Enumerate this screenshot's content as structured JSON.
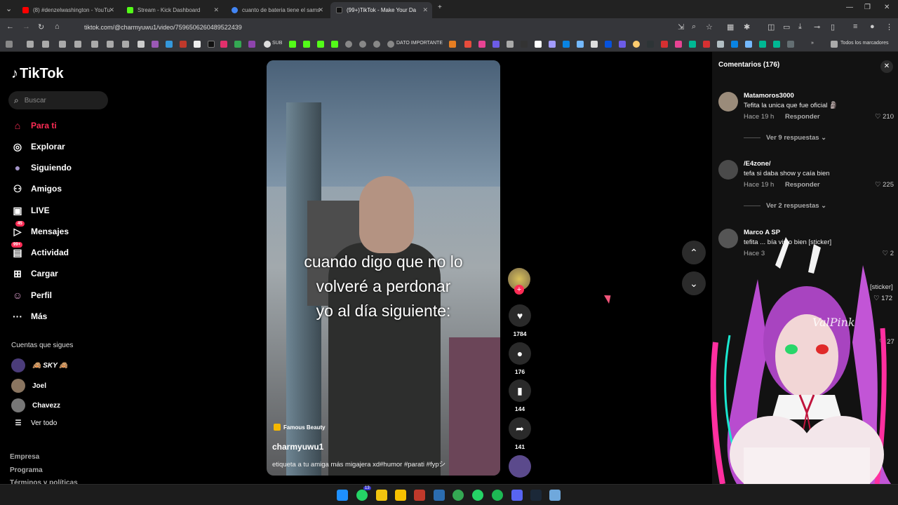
{
  "browser": {
    "tabs": [
      {
        "label": "(8) #denzelwashington - YouTu",
        "color": "#ff0000"
      },
      {
        "label": "Stream - Kick Dashboard",
        "color": "#53fc18"
      },
      {
        "label": "cuanto de bateria tiene el sams",
        "color": "#4285f4"
      },
      {
        "label": "(99+)TikTok - Make Your Da",
        "color": "#111111",
        "active": true
      }
    ],
    "url": "tiktok.com/@charmyuwu1/video/7596506260489522439",
    "bookmarks": {
      "sub": "SUB",
      "dato": "DATO IMPORTANTE",
      "all": "Todos los marcadores"
    }
  },
  "sidebar": {
    "logo": "TikTok",
    "search_placeholder": "Buscar",
    "items": [
      {
        "label": "Para ti",
        "icon": "home-icon",
        "glyph": "⌂",
        "active": true
      },
      {
        "label": "Explorar",
        "icon": "compass-icon",
        "glyph": "◎"
      },
      {
        "label": "Siguiendo",
        "icon": "following-icon",
        "glyph": "●"
      },
      {
        "label": "Amigos",
        "icon": "friends-icon",
        "glyph": "⚇"
      },
      {
        "label": "LIVE",
        "icon": "live-icon",
        "glyph": "▣"
      },
      {
        "label": "Mensajes",
        "icon": "messages-icon",
        "glyph": "▷",
        "badge": "45"
      },
      {
        "label": "Actividad",
        "icon": "activity-icon",
        "glyph": "▤",
        "badge": "99+"
      },
      {
        "label": "Cargar",
        "icon": "upload-icon",
        "glyph": "⊞"
      },
      {
        "label": "Perfil",
        "icon": "profile-icon",
        "glyph": "☺"
      },
      {
        "label": "Más",
        "icon": "more-icon",
        "glyph": "···"
      }
    ],
    "following_title": "Cuentas que sigues",
    "following": [
      {
        "name": "🙈 SKY 🙈"
      },
      {
        "name": "Joel"
      },
      {
        "name": "Chavezz"
      },
      {
        "name": "Ver todo"
      }
    ],
    "footer": [
      "Empresa",
      "Programa",
      "Términos y políticas"
    ]
  },
  "video": {
    "caption_lines": [
      "cuando digo que no lo",
      "volveré a perdonar",
      "yo al día siguiente:"
    ],
    "tag": "Famous Beauty",
    "username": "charmyuwu1",
    "description": "etiqueta a tu amiga más migajera xd#humor #parati #fypシ"
  },
  "actions": {
    "likes": "1784",
    "comments": "176",
    "saves": "144",
    "shares": "141"
  },
  "comments_panel": {
    "title": "Comentarios",
    "count": "(176)",
    "comments": [
      {
        "user": "Matamoros3000",
        "text": "Tefita la unica que fue oficial 🗿",
        "time": "Hace 19 h",
        "reply": "Responder",
        "likes": "210",
        "more": "Ver 9 respuestas"
      },
      {
        "user": "/E4zone/",
        "text": "tefa si daba show y caía bien",
        "time": "Hace 19 h",
        "reply": "Responder",
        "likes": "225",
        "more": "Ver 2 respuestas"
      },
      {
        "user": "Marco A SP",
        "text": "tefita ... bía visto bien [sticker]",
        "time": "Hace 3",
        "likes": "2"
      }
    ],
    "partial": {
      "sticker": "[sticker]",
      "likes_a": "172",
      "likes_b": "27"
    }
  },
  "overlay": {
    "signature": "ValPink"
  }
}
